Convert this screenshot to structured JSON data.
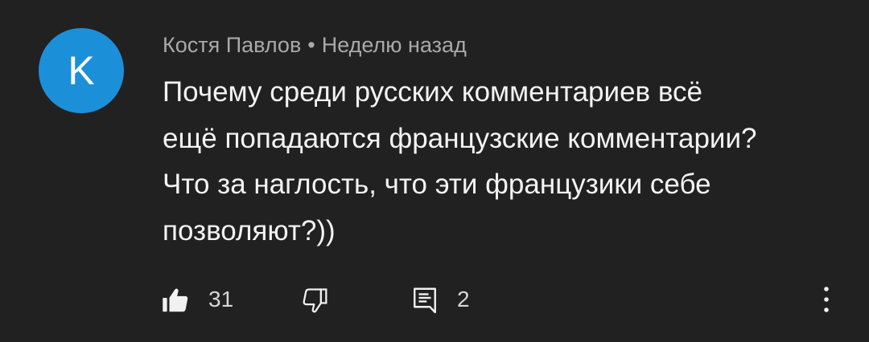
{
  "comment": {
    "avatar_letter": "K",
    "author": "Костя Павлов",
    "separator": "•",
    "time": "Неделю назад",
    "text_lines": [
      "Почему среди русских комментариев всё",
      "ещё попадаются французские комментарии?",
      "Что за наглость, что эти французики себе",
      "позволяют?))"
    ],
    "likes": "31",
    "replies": "2"
  },
  "icons": {
    "like": "thumbs-up-icon",
    "dislike": "thumbs-down-icon",
    "reply": "comment-icon",
    "more": "more-vertical-icon"
  },
  "colors": {
    "background": "#212121",
    "avatar": "#1c8fd9",
    "meta_text": "#a9a9a9",
    "body_text": "#f3f3f3"
  }
}
